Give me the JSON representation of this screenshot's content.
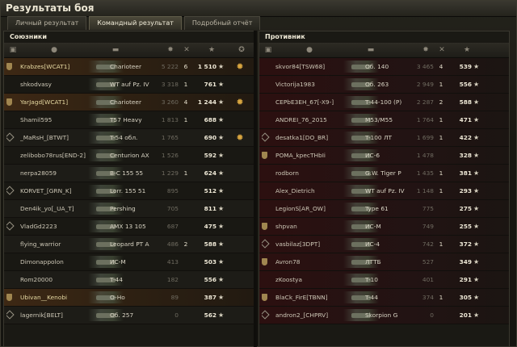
{
  "window": {
    "title": "Результаты боя"
  },
  "tabs": [
    {
      "label": "Личный результат",
      "active": false
    },
    {
      "label": "Командный результат",
      "active": true
    },
    {
      "label": "Подробный отчёт",
      "active": false
    }
  ],
  "allies": {
    "title": "Союзники",
    "rows": [
      {
        "name": "Krabzes[WCAT1]",
        "tank": "Charioteer",
        "damage": "5 222",
        "frags": "6",
        "exp": "1 510",
        "platoon": true,
        "clan": false,
        "medal": true,
        "own": true
      },
      {
        "name": "shkodvasy",
        "tank": "WT auf Pz. IV",
        "damage": "3 318",
        "frags": "1",
        "exp": "761",
        "platoon": false,
        "clan": false,
        "medal": false,
        "own": false
      },
      {
        "name": "YarJagd[WCAT1]",
        "tank": "Charioteer",
        "damage": "3 260",
        "frags": "4",
        "exp": "1 244",
        "platoon": true,
        "clan": false,
        "medal": true,
        "own": true
      },
      {
        "name": "Shamil595",
        "tank": "T57 Heavy",
        "damage": "1 813",
        "frags": "1",
        "exp": "688",
        "platoon": false,
        "clan": false,
        "medal": false,
        "own": false
      },
      {
        "name": "_MaRsH_[BTWT]",
        "tank": "T-54 обл.",
        "damage": "1 765",
        "frags": "",
        "exp": "690",
        "platoon": false,
        "clan": true,
        "medal": true,
        "own": false
      },
      {
        "name": "zelibobo78rus[END-2]",
        "tank": "Centurion AX",
        "damage": "1 526",
        "frags": "",
        "exp": "592",
        "platoon": false,
        "clan": false,
        "medal": false,
        "own": false
      },
      {
        "name": "nerpa28059",
        "tank": "B-C 155 55",
        "damage": "1 229",
        "frags": "1",
        "exp": "624",
        "platoon": false,
        "clan": false,
        "medal": false,
        "own": false
      },
      {
        "name": "KORVET_[GRN_K]",
        "tank": "Lorr. 155 51",
        "damage": "895",
        "frags": "",
        "exp": "512",
        "platoon": false,
        "clan": true,
        "medal": false,
        "own": false
      },
      {
        "name": "Den4ik_yo[_UA_T]",
        "tank": "Pershing",
        "damage": "705",
        "frags": "",
        "exp": "811",
        "platoon": false,
        "clan": false,
        "medal": false,
        "own": false
      },
      {
        "name": "VladGd2223",
        "tank": "AMX 13 105",
        "damage": "687",
        "frags": "",
        "exp": "475",
        "platoon": false,
        "clan": true,
        "medal": false,
        "own": false
      },
      {
        "name": "flying_warrior",
        "tank": "Leopard PT A",
        "damage": "486",
        "frags": "2",
        "exp": "588",
        "platoon": false,
        "clan": false,
        "medal": false,
        "own": false
      },
      {
        "name": "Dimonappolon",
        "tank": "ИС-М",
        "damage": "413",
        "frags": "",
        "exp": "503",
        "platoon": false,
        "clan": false,
        "medal": false,
        "own": false
      },
      {
        "name": "Rom20000",
        "tank": "T-44",
        "damage": "182",
        "frags": "",
        "exp": "556",
        "platoon": false,
        "clan": false,
        "medal": false,
        "own": false
      },
      {
        "name": "Ubivan__Kenobi",
        "tank": "O-Ho",
        "damage": "89",
        "frags": "",
        "exp": "387",
        "platoon": true,
        "clan": false,
        "medal": false,
        "own": true
      },
      {
        "name": "lagernik[BELT]",
        "tank": "Об. 257",
        "damage": "0",
        "frags": "",
        "exp": "562",
        "platoon": false,
        "clan": true,
        "medal": false,
        "own": false
      }
    ]
  },
  "enemies": {
    "title": "Противник",
    "rows": [
      {
        "name": "skvor84[TSW68]",
        "tank": "Об. 140",
        "damage": "3 465",
        "frags": "4",
        "exp": "539",
        "platoon": false,
        "clan": false
      },
      {
        "name": "Victorija1983",
        "tank": "Об. 263",
        "damage": "2 949",
        "frags": "1",
        "exp": "556",
        "platoon": false,
        "clan": false
      },
      {
        "name": "CEPbE3EH_67[-X9-]",
        "tank": "T-44-100 (Р)",
        "damage": "2 287",
        "frags": "2",
        "exp": "588",
        "platoon": false,
        "clan": false
      },
      {
        "name": "ANDREI_76_2015",
        "tank": "M53/M55",
        "damage": "1 764",
        "frags": "1",
        "exp": "471",
        "platoon": false,
        "clan": false
      },
      {
        "name": "desatka1[DO_BR]",
        "tank": "T-100 ЛТ",
        "damage": "1 699",
        "frags": "1",
        "exp": "422",
        "platoon": false,
        "clan": true
      },
      {
        "name": "POMA_kpecTHbIi",
        "tank": "ИС-6",
        "damage": "1 478",
        "frags": "",
        "exp": "328",
        "platoon": true,
        "clan": true
      },
      {
        "name": "rodborn",
        "tank": "G.W. Tiger P",
        "damage": "1 435",
        "frags": "1",
        "exp": "381",
        "platoon": false,
        "clan": false
      },
      {
        "name": "Alex_Dietrich",
        "tank": "WT auf Pz. IV",
        "damage": "1 148",
        "frags": "1",
        "exp": "293",
        "platoon": false,
        "clan": false
      },
      {
        "name": "LegionS[AR_OW]",
        "tank": "Type 61",
        "damage": "775",
        "frags": "",
        "exp": "275",
        "platoon": false,
        "clan": false
      },
      {
        "name": "shpvan",
        "tank": "ИС-М",
        "damage": "749",
        "frags": "",
        "exp": "255",
        "platoon": true,
        "clan": false
      },
      {
        "name": "vasbilaz[3DPT]",
        "tank": "ИС-4",
        "damage": "742",
        "frags": "1",
        "exp": "372",
        "platoon": false,
        "clan": true
      },
      {
        "name": "Avron78",
        "tank": "ЛТТБ",
        "damage": "527",
        "frags": "",
        "exp": "349",
        "platoon": true,
        "clan": false
      },
      {
        "name": "zKoostya",
        "tank": "T-10",
        "damage": "401",
        "frags": "",
        "exp": "291",
        "platoon": false,
        "clan": false
      },
      {
        "name": "BlaCk_FirE[TBNN]",
        "tank": "T-44",
        "damage": "374",
        "frags": "1",
        "exp": "305",
        "platoon": true,
        "clan": false
      },
      {
        "name": "andron2_[CHPRV]",
        "tank": "Skorpion G",
        "damage": "0",
        "frags": "",
        "exp": "201",
        "platoon": false,
        "clan": true
      }
    ]
  },
  "colors": {
    "accent": "#d9a640",
    "ally_highlight": "#3d2814",
    "enemy_tint": "#2c1010"
  },
  "icons": {
    "star": "star-icon",
    "medal": "medal-icon",
    "platoon": "platoon-badge-icon",
    "clan": "clan-diamond-icon"
  }
}
